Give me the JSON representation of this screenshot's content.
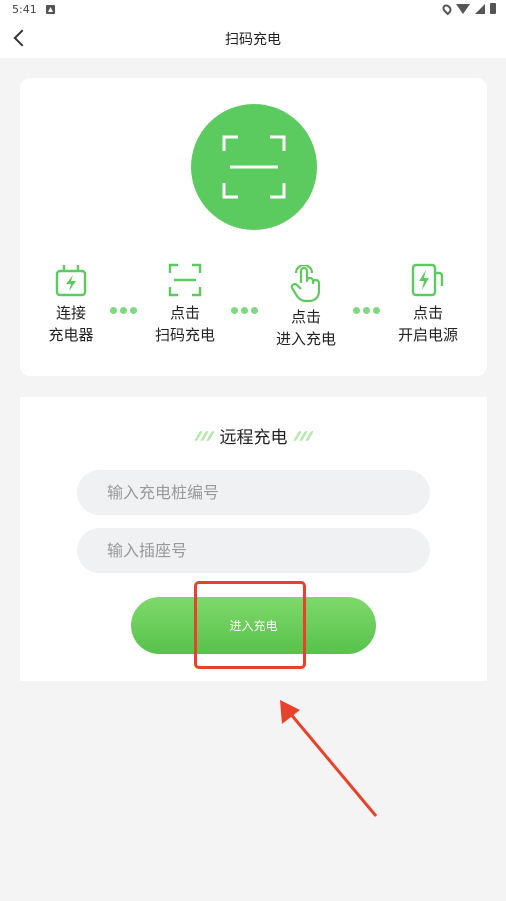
{
  "status_bar": {
    "time": "5:41"
  },
  "nav": {
    "title": "扫码充电"
  },
  "steps": [
    {
      "line1": "连接",
      "line2": "充电器",
      "icon": "plug-icon"
    },
    {
      "line1": "点击",
      "line2": "扫码充电",
      "icon": "scan-icon"
    },
    {
      "line1": "点击",
      "line2": "进入充电",
      "icon": "tap-hand-icon"
    },
    {
      "line1": "点击",
      "line2": "开启电源",
      "icon": "charging-station-icon"
    }
  ],
  "remote": {
    "title": "远程充电",
    "pile_placeholder": "输入充电桩编号",
    "socket_placeholder": "输入插座号",
    "enter_label": "进入充电"
  },
  "colors": {
    "accent": "#5ccb5f",
    "annotation": "#e8412c"
  }
}
